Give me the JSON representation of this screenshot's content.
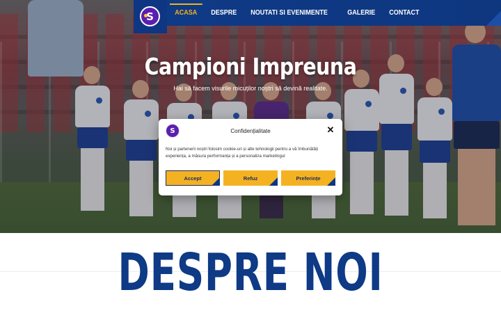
{
  "brand": {
    "logo_letter": "S",
    "primary_color": "#0e3a86",
    "accent_color": "#f4b223",
    "logo_color": "#5b1fb0"
  },
  "nav": {
    "items": [
      {
        "label": "ACASA",
        "active": true
      },
      {
        "label": "DESPRE",
        "active": false
      },
      {
        "label": "NOUTATI SI EVENIMENTE",
        "active": false
      },
      {
        "label": "GALERIE",
        "active": false
      },
      {
        "label": "CONTACT",
        "active": false
      }
    ]
  },
  "hero": {
    "title": "Campioni Impreuna",
    "subtitle": "Hai să facem visurile micuților noștri să devină realitate."
  },
  "cookie_modal": {
    "title": "Confidențialitate",
    "close_icon": "close-icon",
    "text": "Noi și partenerii noștri folosim cookie-uri și alte tehnologii pentru a vă îmbunătăți experiența, a măsura performanța și a personaliza marketingul",
    "buttons": {
      "accept": "Accept",
      "deny": "Refuz",
      "preferences": "Preferințe"
    }
  },
  "about": {
    "title": "DESPRE NOI"
  }
}
